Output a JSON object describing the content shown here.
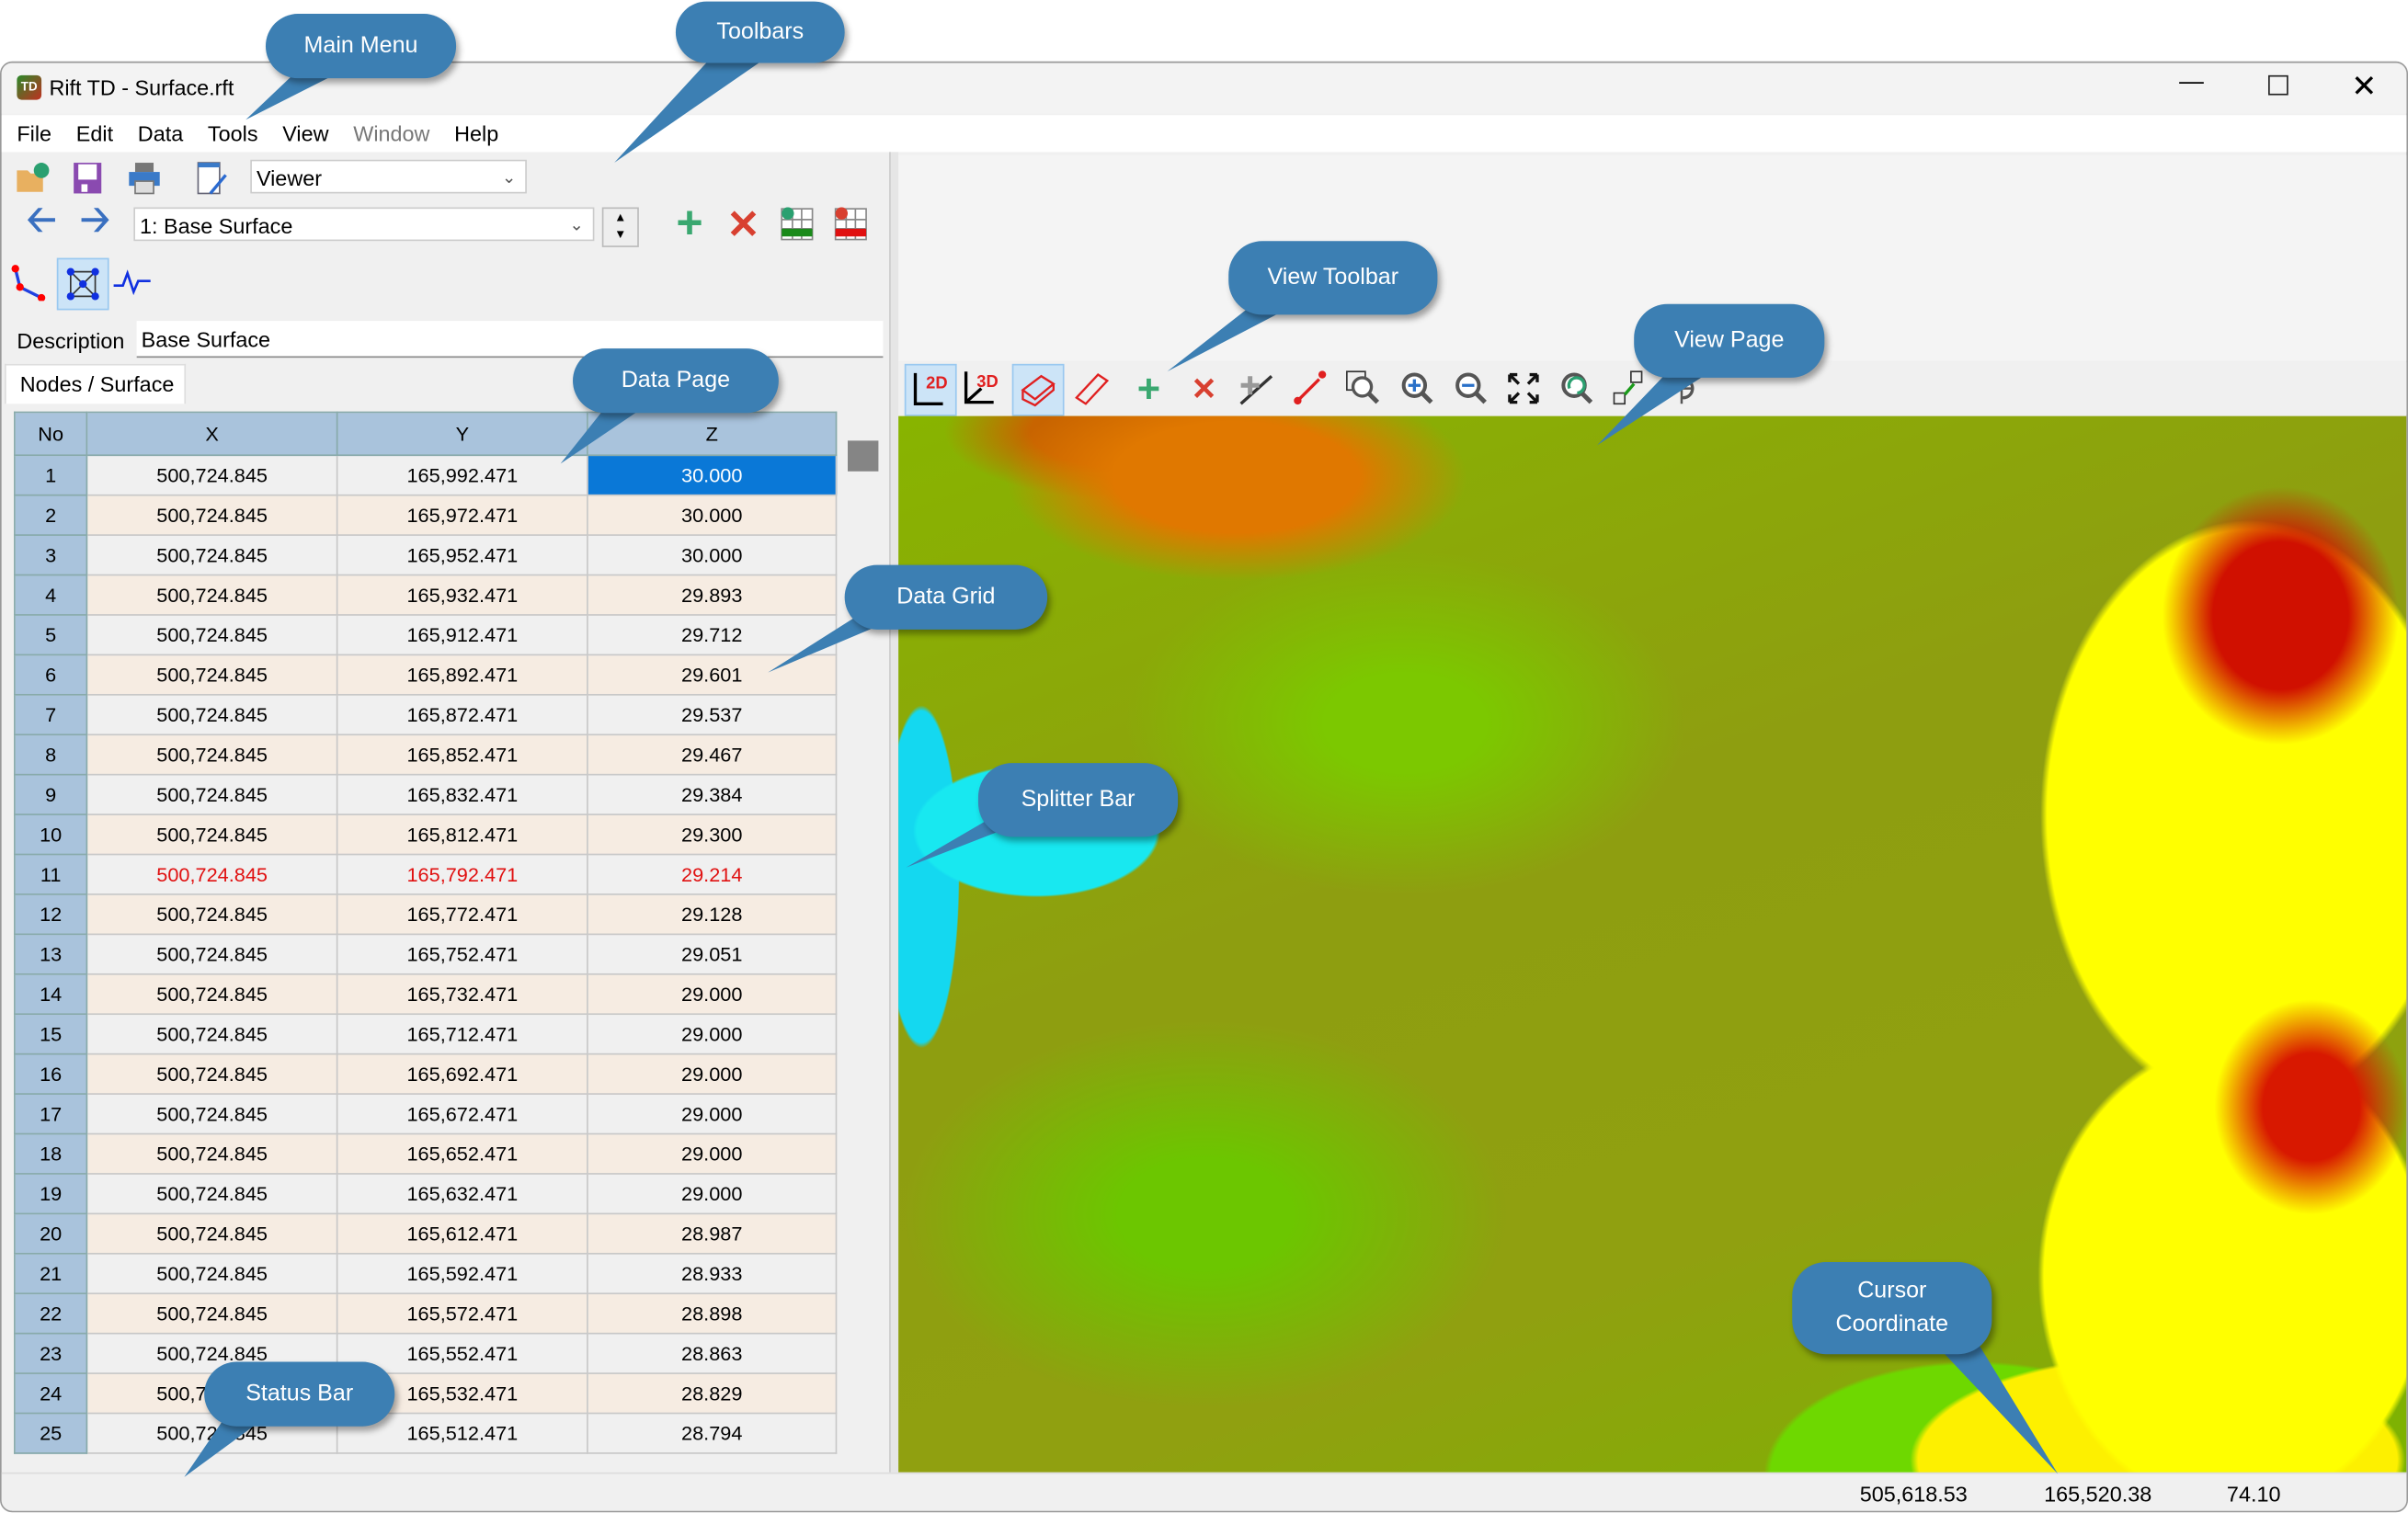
{
  "window": {
    "title": "Rift TD - Surface.rft",
    "app_icon": "rift-td-logo"
  },
  "menu": [
    "File",
    "Edit",
    "Data",
    "Tools",
    "View",
    "Window",
    "Help"
  ],
  "toolbar": {
    "mode_combo": "Viewer",
    "surface_combo": "1: Base Surface",
    "icons": [
      "open-icon",
      "save-icon",
      "print-icon",
      "edit-report-icon",
      "back-arrow-icon",
      "forward-arrow-icon",
      "add-icon",
      "delete-icon",
      "add-rows-icon",
      "delete-rows-icon",
      "polyline-icon",
      "mesh-icon",
      "profile-icon"
    ]
  },
  "description": {
    "label": "Description",
    "value": "Base Surface"
  },
  "tab": "Nodes / Surface",
  "grid": {
    "columns": [
      "No",
      "X",
      "Y",
      "Z"
    ],
    "rows": [
      [
        "1",
        "500,724.845",
        "165,992.471",
        "30.000"
      ],
      [
        "2",
        "500,724.845",
        "165,972.471",
        "30.000"
      ],
      [
        "3",
        "500,724.845",
        "165,952.471",
        "30.000"
      ],
      [
        "4",
        "500,724.845",
        "165,932.471",
        "29.893"
      ],
      [
        "5",
        "500,724.845",
        "165,912.471",
        "29.712"
      ],
      [
        "6",
        "500,724.845",
        "165,892.471",
        "29.601"
      ],
      [
        "7",
        "500,724.845",
        "165,872.471",
        "29.537"
      ],
      [
        "8",
        "500,724.845",
        "165,852.471",
        "29.467"
      ],
      [
        "9",
        "500,724.845",
        "165,832.471",
        "29.384"
      ],
      [
        "10",
        "500,724.845",
        "165,812.471",
        "29.300"
      ],
      [
        "11",
        "500,724.845",
        "165,792.471",
        "29.214"
      ],
      [
        "12",
        "500,724.845",
        "165,772.471",
        "29.128"
      ],
      [
        "13",
        "500,724.845",
        "165,752.471",
        "29.051"
      ],
      [
        "14",
        "500,724.845",
        "165,732.471",
        "29.000"
      ],
      [
        "15",
        "500,724.845",
        "165,712.471",
        "29.000"
      ],
      [
        "16",
        "500,724.845",
        "165,692.471",
        "29.000"
      ],
      [
        "17",
        "500,724.845",
        "165,672.471",
        "29.000"
      ],
      [
        "18",
        "500,724.845",
        "165,652.471",
        "29.000"
      ],
      [
        "19",
        "500,724.845",
        "165,632.471",
        "29.000"
      ],
      [
        "20",
        "500,724.845",
        "165,612.471",
        "28.987"
      ],
      [
        "21",
        "500,724.845",
        "165,592.471",
        "28.933"
      ],
      [
        "22",
        "500,724.845",
        "165,572.471",
        "28.898"
      ],
      [
        "23",
        "500,724.845",
        "165,552.471",
        "28.863"
      ],
      [
        "24",
        "500,724.845",
        "165,532.471",
        "28.829"
      ],
      [
        "25",
        "500,724.845",
        "165,512.471",
        "28.794"
      ]
    ],
    "selected_cell": {
      "row": 1,
      "column": "Z"
    },
    "highlighted_row": 11,
    "highlight_color": "#e01010",
    "selection_color": "#0a78d7"
  },
  "view_toolbar": {
    "icons": [
      "view-2d-icon",
      "view-3d-icon",
      "solid-box-icon",
      "wire-box-icon",
      "add-point-icon",
      "delete-point-icon",
      "add-breakline-icon",
      "draw-line-icon",
      "zoom-window-icon",
      "zoom-in-icon",
      "zoom-out-icon",
      "zoom-extents-icon",
      "zoom-previous-icon",
      "pan-icon",
      "rotate-icon"
    ],
    "label_2d": "2D",
    "label_3d": "3D"
  },
  "status": {
    "x": "505,618.53",
    "y": "165,520.38",
    "z": "74.10"
  },
  "callouts": {
    "main_menu": "Main Menu",
    "toolbars": "Toolbars",
    "view_toolbar": "View Toolbar",
    "view_page": "View Page",
    "data_page": "Data Page",
    "data_grid": "Data Grid",
    "splitter_bar": "Splitter Bar",
    "status_bar": "Status Bar",
    "cursor_coordinate": "Cursor Coordinate"
  },
  "colors": {
    "callout": "#3c7fb3",
    "grid_header": "#a9c3dc",
    "row_alt": "#f6ece2"
  }
}
